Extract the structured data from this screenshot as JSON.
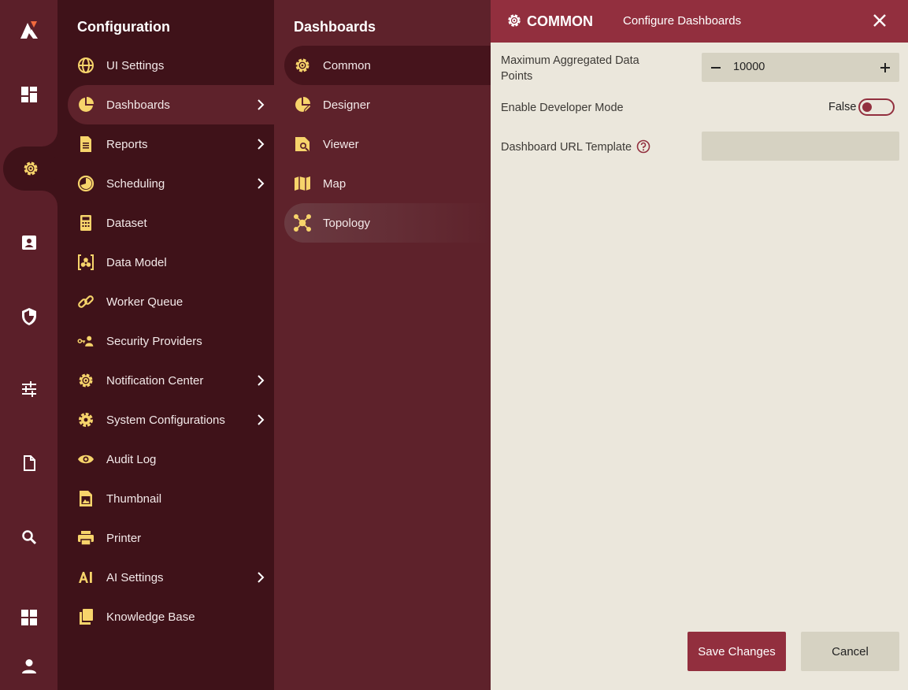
{
  "colors": {
    "rail_bg": "#5b1f29",
    "menu_bg": "#3f1219",
    "submenu_bg": "#5e222b",
    "accent": "#922f3e",
    "icon_yellow": "#f7d46b",
    "panel_bg": "#ebe7dc",
    "input_bg": "#d6d2c2"
  },
  "rail": {
    "icons": [
      "logo-icon",
      "dashboard-icon",
      "gear-icon",
      "contact-card-icon",
      "shield-icon",
      "sliders-icon",
      "document-icon",
      "search-icon",
      "grid-icon",
      "user-icon"
    ],
    "active": "gear-icon"
  },
  "configuration": {
    "title": "Configuration",
    "items": [
      {
        "label": "UI Settings",
        "icon": "globe-icon",
        "chevron": false
      },
      {
        "label": "Dashboards",
        "icon": "pie-chart-icon",
        "chevron": true,
        "active": true
      },
      {
        "label": "Reports",
        "icon": "report-icon",
        "chevron": true
      },
      {
        "label": "Scheduling",
        "icon": "clock-icon",
        "chevron": true
      },
      {
        "label": "Dataset",
        "icon": "calculator-icon",
        "chevron": false
      },
      {
        "label": "Data Model",
        "icon": "data-model-icon",
        "chevron": false
      },
      {
        "label": "Worker Queue",
        "icon": "link-icon",
        "chevron": false
      },
      {
        "label": "Security Providers",
        "icon": "key-user-icon",
        "chevron": false
      },
      {
        "label": "Notification Center",
        "icon": "cog-outline-icon",
        "chevron": true
      },
      {
        "label": "System Configurations",
        "icon": "cog-filled-icon",
        "chevron": true
      },
      {
        "label": "Audit Log",
        "icon": "eye-icon",
        "chevron": false
      },
      {
        "label": "Thumbnail",
        "icon": "image-icon",
        "chevron": false
      },
      {
        "label": "Printer",
        "icon": "printer-icon",
        "chevron": false
      },
      {
        "label": "AI Settings",
        "icon": "ai-icon",
        "chevron": true
      },
      {
        "label": "Knowledge Base",
        "icon": "books-icon",
        "chevron": false
      }
    ]
  },
  "dashboards": {
    "title": "Dashboards",
    "items": [
      {
        "label": "Common",
        "icon": "cog-outline-icon",
        "active": true
      },
      {
        "label": "Designer",
        "icon": "designer-icon"
      },
      {
        "label": "Viewer",
        "icon": "viewer-icon"
      },
      {
        "label": "Map",
        "icon": "map-icon"
      },
      {
        "label": "Topology",
        "icon": "topology-icon",
        "hover": true
      }
    ]
  },
  "panel": {
    "title": "COMMON",
    "subtitle": "Configure Dashboards",
    "fields": {
      "max_points_label": "Maximum Aggregated Data Points",
      "max_points_value": "10000",
      "dev_mode_label": "Enable Developer Mode",
      "dev_mode_state": "False",
      "url_template_label": "Dashboard URL Template",
      "url_template_value": ""
    },
    "save_label": "Save Changes",
    "cancel_label": "Cancel"
  }
}
